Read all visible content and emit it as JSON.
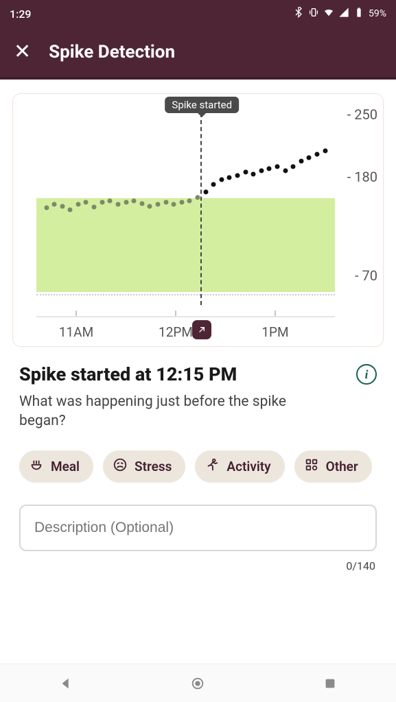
{
  "status_bar": {
    "time": "1:29",
    "battery_pct": "59%"
  },
  "app_bar": {
    "title": "Spike Detection"
  },
  "chart_data": {
    "type": "scatter",
    "x_axis_labels": [
      "11AM",
      "12PM",
      "1PM"
    ],
    "y_ticks": [
      70,
      180,
      250
    ],
    "y_range": [
      60,
      270
    ],
    "target_band": {
      "low": 70,
      "high": 175
    },
    "spike_marker": {
      "x": 12.25,
      "label": "Spike started"
    },
    "points_pre": [
      {
        "x": 10.7,
        "y": 164
      },
      {
        "x": 10.78,
        "y": 168
      },
      {
        "x": 10.86,
        "y": 166
      },
      {
        "x": 10.94,
        "y": 162
      },
      {
        "x": 11.02,
        "y": 168
      },
      {
        "x": 11.1,
        "y": 170
      },
      {
        "x": 11.18,
        "y": 165
      },
      {
        "x": 11.26,
        "y": 170
      },
      {
        "x": 11.34,
        "y": 172
      },
      {
        "x": 11.42,
        "y": 168
      },
      {
        "x": 11.5,
        "y": 170
      },
      {
        "x": 11.58,
        "y": 172
      },
      {
        "x": 11.66,
        "y": 169
      },
      {
        "x": 11.74,
        "y": 166
      },
      {
        "x": 11.82,
        "y": 168
      },
      {
        "x": 11.9,
        "y": 170
      },
      {
        "x": 11.98,
        "y": 168
      },
      {
        "x": 12.06,
        "y": 170
      },
      {
        "x": 12.14,
        "y": 172
      },
      {
        "x": 12.22,
        "y": 176
      }
    ],
    "points_post": [
      {
        "x": 12.3,
        "y": 182
      },
      {
        "x": 12.38,
        "y": 190
      },
      {
        "x": 12.46,
        "y": 196
      },
      {
        "x": 12.54,
        "y": 198
      },
      {
        "x": 12.62,
        "y": 200
      },
      {
        "x": 12.7,
        "y": 204
      },
      {
        "x": 12.78,
        "y": 202
      },
      {
        "x": 12.86,
        "y": 206
      },
      {
        "x": 12.94,
        "y": 208
      },
      {
        "x": 13.02,
        "y": 210
      },
      {
        "x": 13.1,
        "y": 206
      },
      {
        "x": 13.18,
        "y": 210
      },
      {
        "x": 13.26,
        "y": 216
      },
      {
        "x": 13.34,
        "y": 220
      },
      {
        "x": 13.42,
        "y": 224
      },
      {
        "x": 13.5,
        "y": 228
      }
    ],
    "x_range": [
      10.6,
      13.6
    ]
  },
  "headline": "Spike started at 12:15 PM",
  "question": "What was happening just before the spike began?",
  "chips": {
    "meal": "Meal",
    "stress": "Stress",
    "activity": "Activity",
    "other": "Other"
  },
  "description_placeholder": "Description (Optional)",
  "char_counter": "0/140"
}
